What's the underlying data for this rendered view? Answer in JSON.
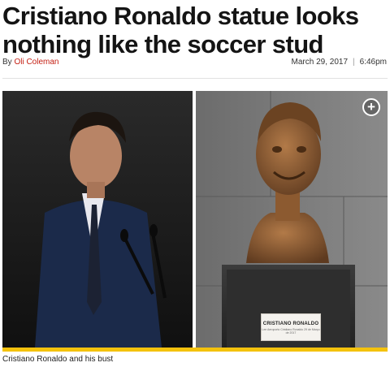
{
  "article": {
    "headline": "Cristiano Ronaldo statue looks nothing like the soccer stud",
    "byline_prefix": "By",
    "author": "Oli Coleman",
    "date": "March 29, 2017",
    "separator": "|",
    "time": "6:46pm"
  },
  "photo": {
    "expand_icon": "plus-circle-icon",
    "expand_label": "+",
    "plaque_title": "CRISTIANO RONALDO",
    "plaque_sub": "Lee Aeroporto Cristiano Ronaldo 29 de Março de 2017",
    "caption": "Cristiano Ronaldo and his bust",
    "accent_color": "#f4c20d"
  }
}
